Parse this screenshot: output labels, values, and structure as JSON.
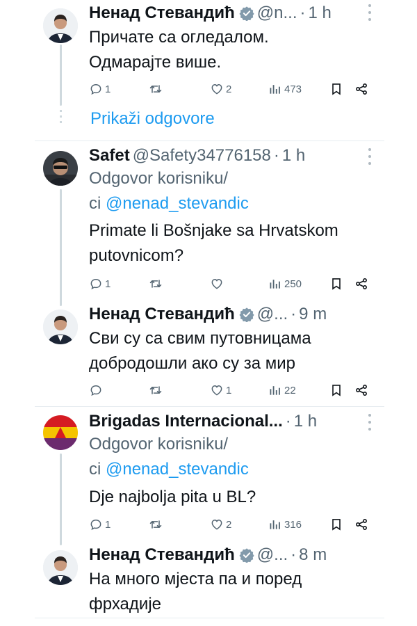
{
  "tweets": [
    {
      "name": "Ненад Стевандић",
      "handle": "@n...",
      "time": "1 h",
      "text": "Причате са огледалом.\nОдмарајте више.",
      "reply_label": "",
      "reply_handle": "",
      "counts": {
        "replies": "1",
        "retweets": "",
        "likes": "2",
        "views": "473"
      },
      "verified": true
    },
    {
      "name": "Safet",
      "handle": "@Safety34776158",
      "time": "1 h",
      "reply_label": "Odgovor korisniku/\nci ",
      "reply_handle": "@nenad_stevandic",
      "text": "Primate li Bošnjake sa Hrvatskom putovnicom?",
      "counts": {
        "replies": "1",
        "retweets": "",
        "likes": "",
        "views": "250"
      },
      "verified": false
    },
    {
      "name": "Ненад Стевандић",
      "handle": "@...",
      "time": "9 m",
      "text": "Сви су са свим путовницама добродошли ако су за мир",
      "reply_label": "",
      "reply_handle": "",
      "counts": {
        "replies": "",
        "retweets": "",
        "likes": "1",
        "views": "22"
      },
      "verified": true
    },
    {
      "name": "Brigadas Internacional...",
      "handle": "",
      "time": "1 h",
      "reply_label": "Odgovor korisniku/\nci ",
      "reply_handle": "@nenad_stevandic",
      "text": "Dje najbolja pita u BL?",
      "counts": {
        "replies": "1",
        "retweets": "",
        "likes": "2",
        "views": "316"
      },
      "verified": false
    },
    {
      "name": "Ненад Стевандић",
      "handle": "@...",
      "time": "8 m",
      "text": "На много мјеста па и поред фрхадије",
      "reply_label": "",
      "reply_handle": "",
      "counts": {
        "replies": "",
        "retweets": "",
        "likes": "",
        "views": ""
      },
      "verified": true
    }
  ],
  "show_replies": "Prikaži odgovore",
  "icons": {
    "reply": "reply-icon",
    "retweet": "retweet-icon",
    "like": "heart-icon",
    "views": "views-icon",
    "bookmark": "bookmark-icon",
    "share": "share-icon",
    "verified": "verified-badge-icon",
    "more": "more-icon"
  },
  "colors": {
    "link": "#1d9bf0",
    "secondary": "#536471",
    "verified": "#829aab"
  }
}
